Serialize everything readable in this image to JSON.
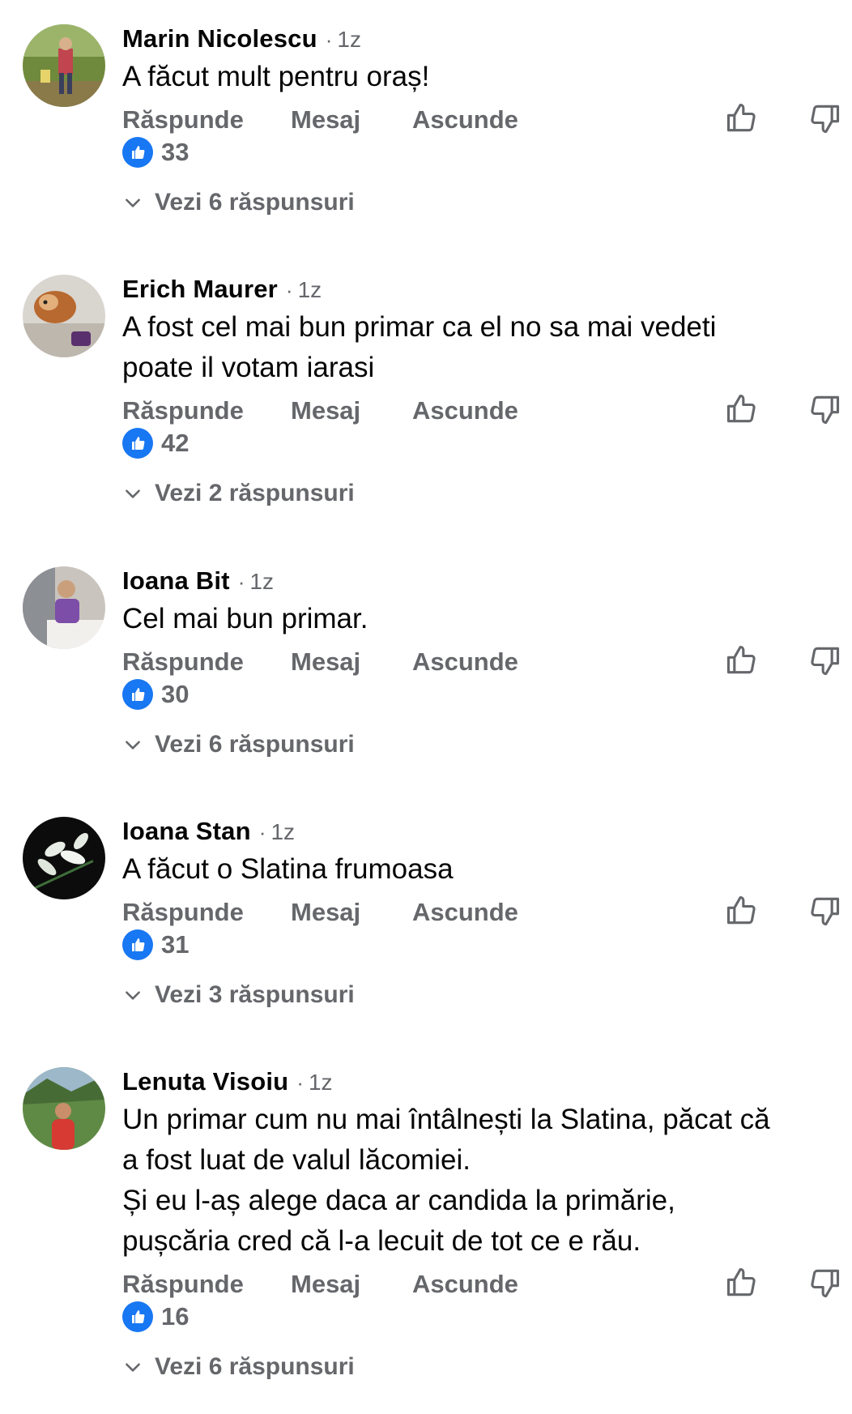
{
  "labels": {
    "reply": "Răspunde",
    "message": "Mesaj",
    "hide": "Ascunde"
  },
  "icons": {
    "like_badge": "thumbs-up-icon",
    "upvote": "thumbs-up-outline-icon",
    "downvote": "thumbs-down-outline-icon",
    "expand": "chevron-down-icon"
  },
  "colors": {
    "accent": "#1877f2",
    "secondary_text": "#65676b",
    "primary_text": "#050505"
  },
  "comments": [
    {
      "author": "Marin Nicolescu",
      "age": "1z",
      "text": "A făcut mult pentru oraș!",
      "likes": "33",
      "replies_label": "Vezi 6 răspunsuri"
    },
    {
      "author": "Erich Maurer",
      "age": "1z",
      "text": "A fost cel mai bun primar ca el no sa mai vedeti\npoate il votam iarasi",
      "likes": "42",
      "replies_label": "Vezi 2 răspunsuri"
    },
    {
      "author": "Ioana Bit",
      "age": "1z",
      "text": "Cel mai bun primar.",
      "likes": "30",
      "replies_label": "Vezi 6 răspunsuri"
    },
    {
      "author": "Ioana Stan",
      "age": "1z",
      "text": "A făcut o Slatina frumoasa",
      "likes": "31",
      "replies_label": "Vezi 3 răspunsuri"
    },
    {
      "author": "Lenuta Visoiu",
      "age": "1z",
      "text": "Un primar cum nu mai întâlnești la Slatina, păcat că\na fost luat de valul lăcomiei.\nȘi eu l-aș alege daca ar candida la primărie,\npușcăria cred că l-a lecuit de tot ce e rău.",
      "likes": "16",
      "replies_label": "Vezi 6 răspunsuri"
    }
  ]
}
